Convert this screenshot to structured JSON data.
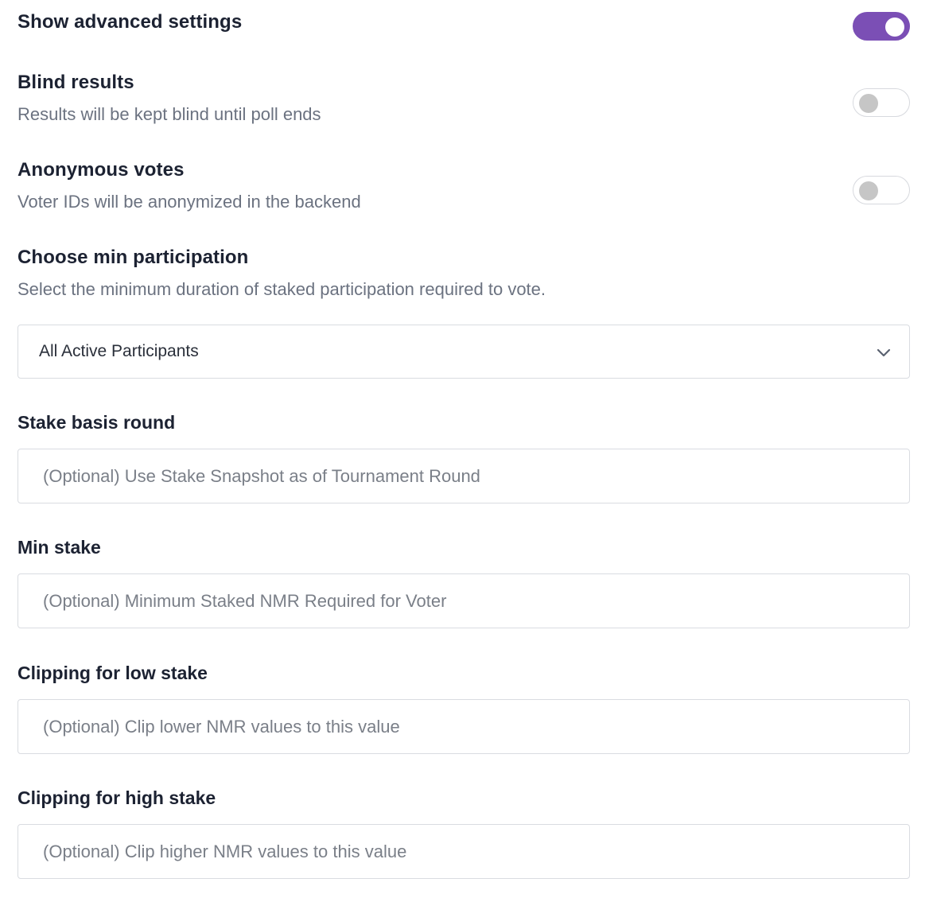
{
  "advanced": {
    "title": "Show advanced settings",
    "enabled": true,
    "accent_color": "#7b4fb5"
  },
  "blind_results": {
    "title": "Blind results",
    "description": "Results will be kept blind until poll ends",
    "enabled": false
  },
  "anonymous_votes": {
    "title": "Anonymous votes",
    "description": "Voter IDs will be anonymized in the backend",
    "enabled": false
  },
  "min_participation": {
    "title": "Choose min participation",
    "description": "Select the minimum duration of staked participation required to vote.",
    "selected": "All Active Participants"
  },
  "stake_basis_round": {
    "label": "Stake basis round",
    "placeholder": "(Optional) Use Stake Snapshot as of Tournament Round",
    "value": ""
  },
  "min_stake": {
    "label": "Min stake",
    "placeholder": "(Optional) Minimum Staked NMR Required for Voter",
    "value": ""
  },
  "clip_low": {
    "label": "Clipping for low stake",
    "placeholder": "(Optional) Clip lower NMR values to this value",
    "value": ""
  },
  "clip_high": {
    "label": "Clipping for high stake",
    "placeholder": "(Optional) Clip higher NMR values to this value",
    "value": ""
  }
}
